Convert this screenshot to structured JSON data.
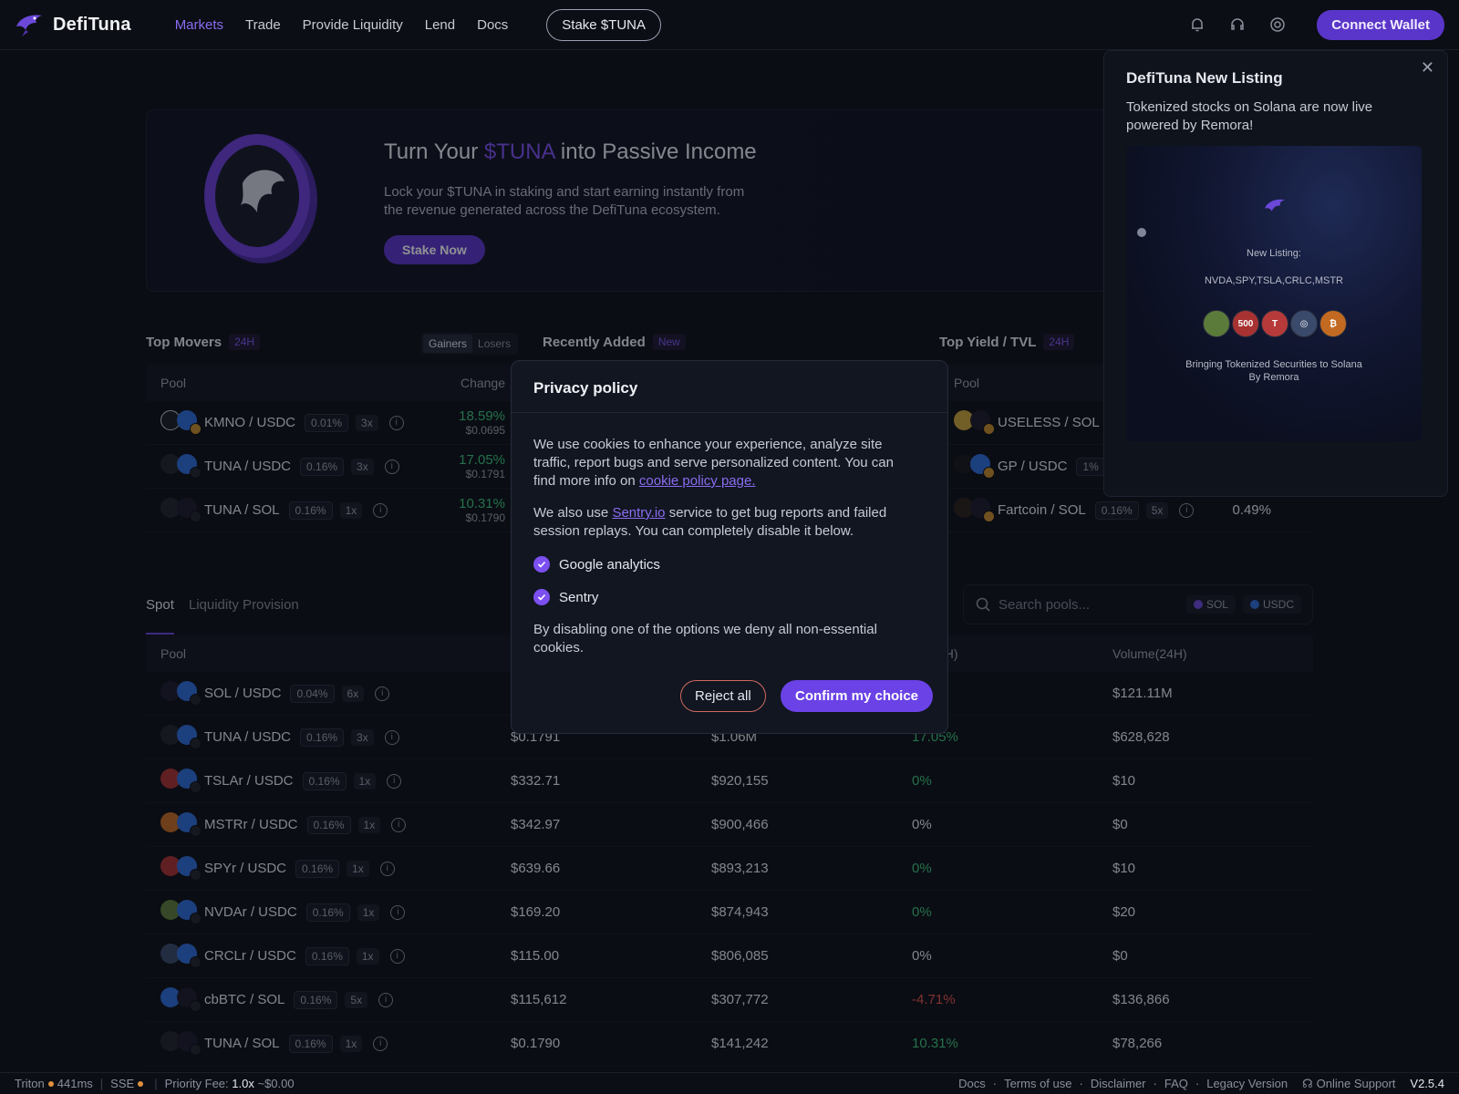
{
  "brand": {
    "name": "DefiTuna"
  },
  "nav": {
    "items": [
      "Markets",
      "Trade",
      "Provide Liquidity",
      "Lend",
      "Docs"
    ],
    "stake_pill": "Stake $TUNA"
  },
  "header": {
    "connect_wallet": "Connect Wallet"
  },
  "banner": {
    "title_pre": "Turn Your ",
    "title_accent": "$TUNA",
    "title_post": " into Passive Income",
    "desc": "Lock your $TUNA in staking and start earning instantly from the revenue generated across the DefiTuna ecosystem.",
    "button": "Stake Now"
  },
  "top_movers": {
    "title": "Top Movers",
    "tag": "24H",
    "toggle": [
      "Gainers",
      "Losers"
    ],
    "col_pool": "Pool",
    "col_change": "Change",
    "rows": [
      {
        "pair": "KMNO / USDC",
        "fee": "0.01%",
        "lev": "3x",
        "change": "18.59%",
        "price": "$0.0695"
      },
      {
        "pair": "TUNA / USDC",
        "fee": "0.16%",
        "lev": "3x",
        "change": "17.05%",
        "price": "$0.1791"
      },
      {
        "pair": "TUNA / SOL",
        "fee": "0.16%",
        "lev": "1x",
        "change": "10.31%",
        "price": "$0.1790"
      }
    ]
  },
  "recently_added": {
    "title": "Recently Added",
    "tag": "New"
  },
  "top_yield": {
    "title": "Top Yield / TVL",
    "tag": "24H",
    "col_pool": "Pool",
    "rows": [
      {
        "pair": "USELESS / SOL",
        "fee": "",
        "lev": "",
        "value": ""
      },
      {
        "pair": "GP / USDC",
        "fee": "1%",
        "lev": "",
        "value": ""
      },
      {
        "pair": "Fartcoin / SOL",
        "fee": "0.16%",
        "lev": "5x",
        "value": "0.49%"
      }
    ]
  },
  "tabs": [
    "Spot",
    "Liquidity Provision"
  ],
  "search": {
    "placeholder": "Search pools...",
    "chips": [
      "SOL",
      "USDC"
    ]
  },
  "main_table": {
    "headers": [
      "Pool",
      "",
      "",
      "ge(24H)",
      "Volume(24H)"
    ],
    "rows": [
      {
        "pair": "SOL / USDC",
        "fee": "0.04%",
        "lev": "6x",
        "price": "",
        "tvl": "",
        "change": "",
        "volume": "$121.11M",
        "dir": "pos"
      },
      {
        "pair": "TUNA / USDC",
        "fee": "0.16%",
        "lev": "3x",
        "price": "$0.1791",
        "tvl": "$1.06M",
        "change": "17.05%",
        "volume": "$628,628",
        "dir": "pos"
      },
      {
        "pair": "TSLAr / USDC",
        "fee": "0.16%",
        "lev": "1x",
        "price": "$332.71",
        "tvl": "$920,155",
        "change": "0%",
        "volume": "$10",
        "dir": "pos"
      },
      {
        "pair": "MSTRr / USDC",
        "fee": "0.16%",
        "lev": "1x",
        "price": "$342.97",
        "tvl": "$900,466",
        "change": "0%",
        "volume": "$0",
        "dir": "neutral"
      },
      {
        "pair": "SPYr / USDC",
        "fee": "0.16%",
        "lev": "1x",
        "price": "$639.66",
        "tvl": "$893,213",
        "change": "0%",
        "volume": "$10",
        "dir": "pos"
      },
      {
        "pair": "NVDAr / USDC",
        "fee": "0.16%",
        "lev": "1x",
        "price": "$169.20",
        "tvl": "$874,943",
        "change": "0%",
        "volume": "$20",
        "dir": "pos"
      },
      {
        "pair": "CRCLr / USDC",
        "fee": "0.16%",
        "lev": "1x",
        "price": "$115.00",
        "tvl": "$806,085",
        "change": "0%",
        "volume": "$0",
        "dir": "neutral"
      },
      {
        "pair": "cbBTC / SOL",
        "fee": "0.16%",
        "lev": "5x",
        "price": "$115,612",
        "tvl": "$307,772",
        "change": "-4.71%",
        "volume": "$136,866",
        "dir": "neg"
      },
      {
        "pair": "TUNA / SOL",
        "fee": "0.16%",
        "lev": "1x",
        "price": "$0.1790",
        "tvl": "$141,242",
        "change": "10.31%",
        "volume": "$78,266",
        "dir": "pos"
      }
    ]
  },
  "notification": {
    "title": "DefiTuna New Listing",
    "desc": "Tokenized stocks on Solana are now live powered by Remora!",
    "img_label": "New Listing:",
    "img_tickers": "NVDA,SPY,TSLA,CRLC,MSTR",
    "img_caption_1": "Bringing Tokenized Securities to Solana",
    "img_caption_2": "By Remora",
    "coin_500": "500"
  },
  "privacy": {
    "title": "Privacy policy",
    "p1": "We use cookies to enhance your experience, analyze site traffic, report bugs and serve personalized content. You can find more info on ",
    "p1_link": "cookie policy page.",
    "p2_pre": "We also use ",
    "p2_link": "Sentry.io",
    "p2_post": " service to get bug reports and failed session replays. You can completely disable it below.",
    "opt1": "Google analytics",
    "opt2": "Sentry",
    "p3": "By disabling one of the options we deny all non-essential cookies.",
    "reject": "Reject all",
    "confirm": "Confirm my choice"
  },
  "footer": {
    "rpc": "Triton",
    "latency": "441ms",
    "sse": "SSE",
    "priority_label": "Priority Fee:",
    "priority_val": "1.0x",
    "priority_usd": "~$0.00",
    "links": [
      "Docs",
      "Terms of use",
      "Disclaimer",
      "FAQ",
      "Legacy Version"
    ],
    "support": "Online Support",
    "version": "V2.5.4"
  },
  "colors": {
    "accent": "#7c4ff0",
    "positive": "#3cc37a",
    "negative": "#e5534b",
    "background": "#0a0d13"
  }
}
